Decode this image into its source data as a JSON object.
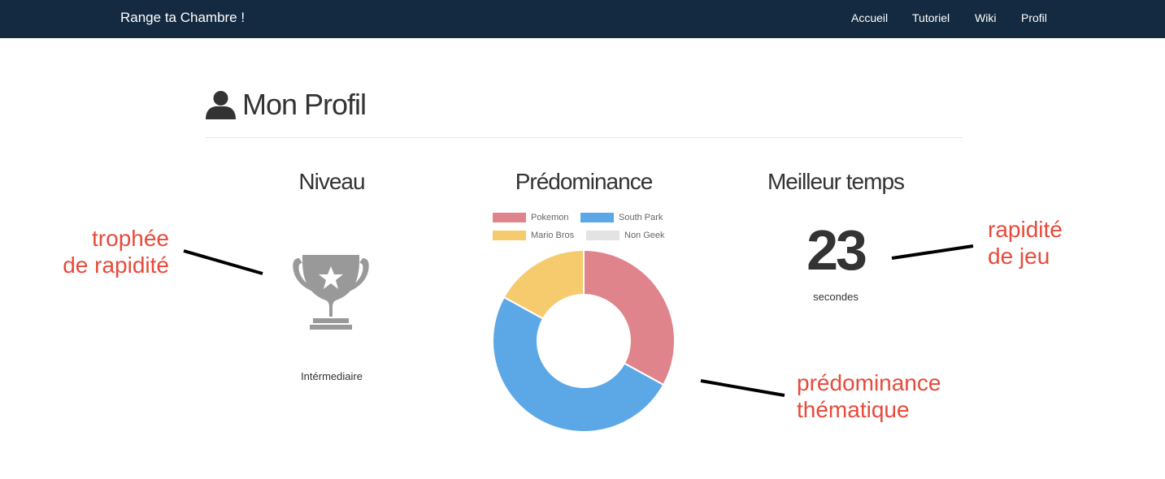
{
  "nav": {
    "brand": "Range ta Chambre !",
    "items": [
      "Accueil",
      "Tutoriel",
      "Wiki",
      "Profil"
    ]
  },
  "page": {
    "title": "Mon Profil"
  },
  "niveau": {
    "title": "Niveau",
    "level": "Intérmediaire",
    "icon": "trophy-icon"
  },
  "meilleur": {
    "title": "Meilleur temps",
    "value": "23",
    "unit": "secondes"
  },
  "annotations": {
    "trophy": [
      "trophée",
      "de rapidité"
    ],
    "speed": [
      "rapidité",
      "de jeu"
    ],
    "theme": [
      "prédominance",
      "thématique"
    ]
  },
  "chart_data": {
    "type": "pie",
    "title": "Prédominance",
    "donut": true,
    "categories": [
      "Pokemon",
      "South Park",
      "Mario Bros",
      "Non Geek"
    ],
    "values": [
      33,
      50,
      17,
      0
    ],
    "colors": [
      "#e0848c",
      "#5ca8e6",
      "#f5cb6e",
      "#e3e3e3"
    ],
    "legend": "top"
  }
}
